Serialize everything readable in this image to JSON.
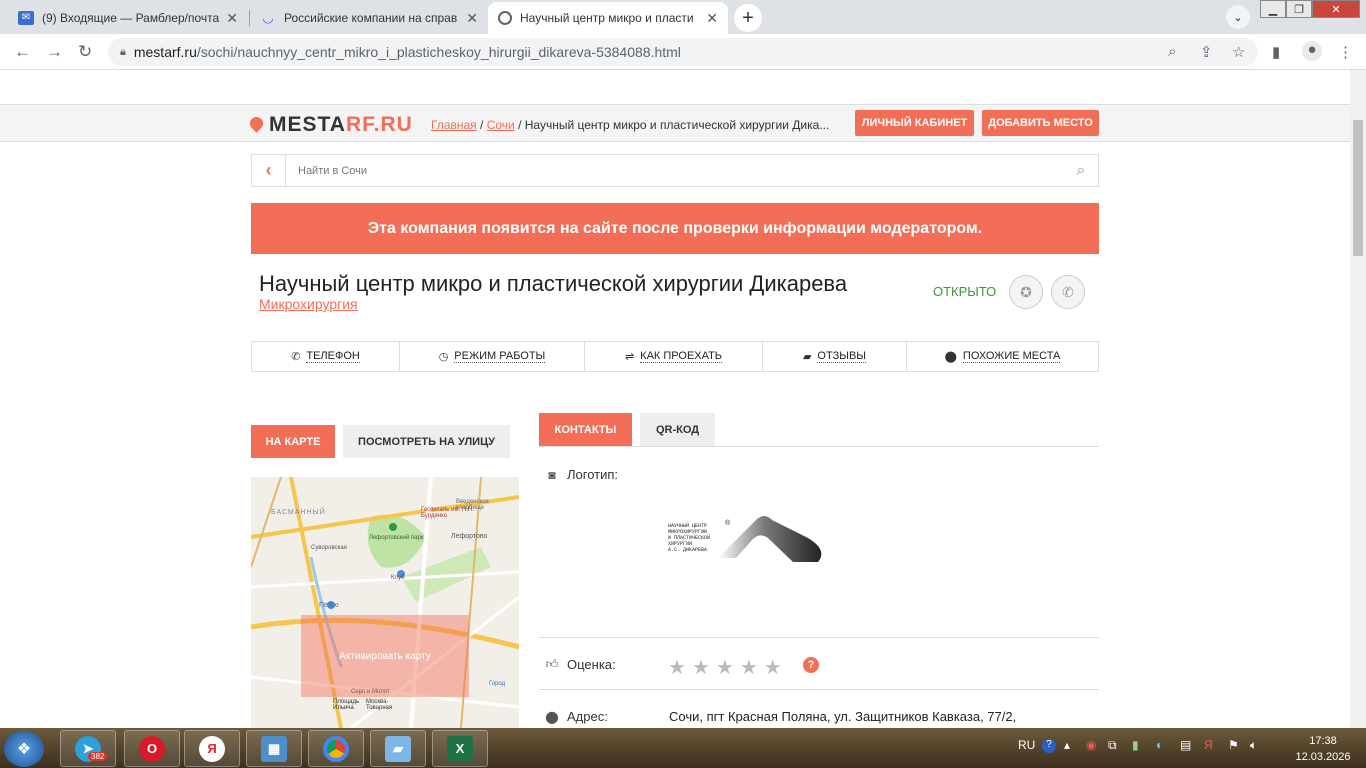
{
  "browser": {
    "tabs": [
      {
        "title": "(9) Входящие — Рамблер/почта",
        "close": "✕"
      },
      {
        "title": "Российские компании на справ",
        "close": "✕"
      },
      {
        "title": "Научный центр микро и пласти",
        "close": "✕"
      }
    ],
    "new_tab": "+",
    "url_host": "mestarf.ru",
    "url_path": "/sochi/nauchnyy_centr_mikro_i_plasticheskoy_hirurgii_dikareva-5384088.html"
  },
  "header": {
    "logo_main": "MESTA",
    "logo_accent": "RF.RU",
    "breadcrumbs": {
      "home": "Главная",
      "sep1": " / ",
      "city": "Сочи",
      "sep2": " / ",
      "current": "Научный центр микро и пластической хирургии Дика..."
    },
    "cabinet_button": "ЛИЧНЫЙ КАБИНЕТ",
    "add_place_button": "ДОБАВИТЬ МЕСТО"
  },
  "search": {
    "placeholder": "Найти в Сочи"
  },
  "notice": "Эта компания появится на сайте после проверки информации модератором.",
  "company": {
    "name": "Научный центр микро и пластической хирургии Дикарева",
    "category": "Микрохирургия",
    "status": "ОТКРЫТО",
    "status_color": "#3b9a34"
  },
  "section_nav": [
    {
      "label": "ТЕЛЕФОН",
      "icon": "phone-icon"
    },
    {
      "label": "РЕЖИМ РАБОТЫ",
      "icon": "clock-icon"
    },
    {
      "label": "КАК ПРОЕХАТЬ",
      "icon": "route-icon"
    },
    {
      "label": "ОТЗЫВЫ",
      "icon": "comment-icon"
    },
    {
      "label": "ПОХОЖИЕ МЕСТА",
      "icon": "pin-icon"
    }
  ],
  "map_tabs": {
    "on_map": "НА КАРТЕ",
    "street_view": "ПОСМОТРЕТЬ НА УЛИЦУ"
  },
  "map": {
    "activate": "Активировать карту",
    "labels": {
      "basmanny": "БАСМАННЫЙ",
      "lefortovo": "Лефортово",
      "lefortovo_park": "Лефортовский парк",
      "hospital": "Госпиталь им. Н.Н. Бурденко",
      "cemetery": "Введенское кладбище",
      "suvorovskaya": "Суворовская",
      "klub": "Клуб",
      "petro": "Петро",
      "ilyicha": "Площадь Ильича",
      "serp": "Серп и Молот",
      "moskva_tovar": "Москва-Товарная",
      "gorod": "Город"
    }
  },
  "content_tabs": {
    "contacts": "КОНТАКТЫ",
    "qr": "QR-КОД"
  },
  "details": {
    "logo_label": "Логотип:",
    "logo_text": "НАУЧНЫЙ ЦЕНТР\nМИКРОХИРУРГИИ\nИ ПЛАСТИЧЕСКОЙ\nХИРУРГИИ\nА.С. ДИКАРЕВА",
    "logo_mark": "®",
    "rating_label": "Оценка:",
    "rating": 0,
    "rating_max": 5,
    "help": "?",
    "address_label": "Адрес:",
    "address": "Сочи, пгт Красная Поляна, ул. Защитников Кавказа, 77/2,"
  },
  "taskbar": {
    "telegram_badge": "382",
    "lang": "RU",
    "time": "17:38",
    "date": "12.03.2026"
  },
  "colors": {
    "accent": "#f26e56",
    "open": "#3b9a34"
  }
}
